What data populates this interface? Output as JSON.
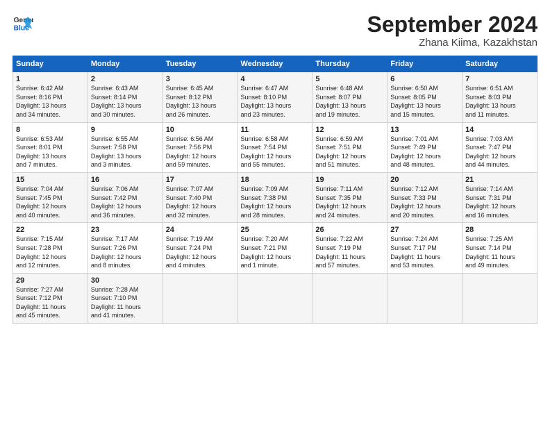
{
  "header": {
    "logo_line1": "General",
    "logo_line2": "Blue",
    "title": "September 2024",
    "subtitle": "Zhana Kiima, Kazakhstan"
  },
  "columns": [
    "Sunday",
    "Monday",
    "Tuesday",
    "Wednesday",
    "Thursday",
    "Friday",
    "Saturday"
  ],
  "weeks": [
    [
      {
        "day": "1",
        "line1": "Sunrise: 6:42 AM",
        "line2": "Sunset: 8:16 PM",
        "line3": "Daylight: 13 hours",
        "line4": "and 34 minutes."
      },
      {
        "day": "2",
        "line1": "Sunrise: 6:43 AM",
        "line2": "Sunset: 8:14 PM",
        "line3": "Daylight: 13 hours",
        "line4": "and 30 minutes."
      },
      {
        "day": "3",
        "line1": "Sunrise: 6:45 AM",
        "line2": "Sunset: 8:12 PM",
        "line3": "Daylight: 13 hours",
        "line4": "and 26 minutes."
      },
      {
        "day": "4",
        "line1": "Sunrise: 6:47 AM",
        "line2": "Sunset: 8:10 PM",
        "line3": "Daylight: 13 hours",
        "line4": "and 23 minutes."
      },
      {
        "day": "5",
        "line1": "Sunrise: 6:48 AM",
        "line2": "Sunset: 8:07 PM",
        "line3": "Daylight: 13 hours",
        "line4": "and 19 minutes."
      },
      {
        "day": "6",
        "line1": "Sunrise: 6:50 AM",
        "line2": "Sunset: 8:05 PM",
        "line3": "Daylight: 13 hours",
        "line4": "and 15 minutes."
      },
      {
        "day": "7",
        "line1": "Sunrise: 6:51 AM",
        "line2": "Sunset: 8:03 PM",
        "line3": "Daylight: 13 hours",
        "line4": "and 11 minutes."
      }
    ],
    [
      {
        "day": "8",
        "line1": "Sunrise: 6:53 AM",
        "line2": "Sunset: 8:01 PM",
        "line3": "Daylight: 13 hours",
        "line4": "and 7 minutes."
      },
      {
        "day": "9",
        "line1": "Sunrise: 6:55 AM",
        "line2": "Sunset: 7:58 PM",
        "line3": "Daylight: 13 hours",
        "line4": "and 3 minutes."
      },
      {
        "day": "10",
        "line1": "Sunrise: 6:56 AM",
        "line2": "Sunset: 7:56 PM",
        "line3": "Daylight: 12 hours",
        "line4": "and 59 minutes."
      },
      {
        "day": "11",
        "line1": "Sunrise: 6:58 AM",
        "line2": "Sunset: 7:54 PM",
        "line3": "Daylight: 12 hours",
        "line4": "and 55 minutes."
      },
      {
        "day": "12",
        "line1": "Sunrise: 6:59 AM",
        "line2": "Sunset: 7:51 PM",
        "line3": "Daylight: 12 hours",
        "line4": "and 51 minutes."
      },
      {
        "day": "13",
        "line1": "Sunrise: 7:01 AM",
        "line2": "Sunset: 7:49 PM",
        "line3": "Daylight: 12 hours",
        "line4": "and 48 minutes."
      },
      {
        "day": "14",
        "line1": "Sunrise: 7:03 AM",
        "line2": "Sunset: 7:47 PM",
        "line3": "Daylight: 12 hours",
        "line4": "and 44 minutes."
      }
    ],
    [
      {
        "day": "15",
        "line1": "Sunrise: 7:04 AM",
        "line2": "Sunset: 7:45 PM",
        "line3": "Daylight: 12 hours",
        "line4": "and 40 minutes."
      },
      {
        "day": "16",
        "line1": "Sunrise: 7:06 AM",
        "line2": "Sunset: 7:42 PM",
        "line3": "Daylight: 12 hours",
        "line4": "and 36 minutes."
      },
      {
        "day": "17",
        "line1": "Sunrise: 7:07 AM",
        "line2": "Sunset: 7:40 PM",
        "line3": "Daylight: 12 hours",
        "line4": "and 32 minutes."
      },
      {
        "day": "18",
        "line1": "Sunrise: 7:09 AM",
        "line2": "Sunset: 7:38 PM",
        "line3": "Daylight: 12 hours",
        "line4": "and 28 minutes."
      },
      {
        "day": "19",
        "line1": "Sunrise: 7:11 AM",
        "line2": "Sunset: 7:35 PM",
        "line3": "Daylight: 12 hours",
        "line4": "and 24 minutes."
      },
      {
        "day": "20",
        "line1": "Sunrise: 7:12 AM",
        "line2": "Sunset: 7:33 PM",
        "line3": "Daylight: 12 hours",
        "line4": "and 20 minutes."
      },
      {
        "day": "21",
        "line1": "Sunrise: 7:14 AM",
        "line2": "Sunset: 7:31 PM",
        "line3": "Daylight: 12 hours",
        "line4": "and 16 minutes."
      }
    ],
    [
      {
        "day": "22",
        "line1": "Sunrise: 7:15 AM",
        "line2": "Sunset: 7:28 PM",
        "line3": "Daylight: 12 hours",
        "line4": "and 12 minutes."
      },
      {
        "day": "23",
        "line1": "Sunrise: 7:17 AM",
        "line2": "Sunset: 7:26 PM",
        "line3": "Daylight: 12 hours",
        "line4": "and 8 minutes."
      },
      {
        "day": "24",
        "line1": "Sunrise: 7:19 AM",
        "line2": "Sunset: 7:24 PM",
        "line3": "Daylight: 12 hours",
        "line4": "and 4 minutes."
      },
      {
        "day": "25",
        "line1": "Sunrise: 7:20 AM",
        "line2": "Sunset: 7:21 PM",
        "line3": "Daylight: 12 hours",
        "line4": "and 1 minute."
      },
      {
        "day": "26",
        "line1": "Sunrise: 7:22 AM",
        "line2": "Sunset: 7:19 PM",
        "line3": "Daylight: 11 hours",
        "line4": "and 57 minutes."
      },
      {
        "day": "27",
        "line1": "Sunrise: 7:24 AM",
        "line2": "Sunset: 7:17 PM",
        "line3": "Daylight: 11 hours",
        "line4": "and 53 minutes."
      },
      {
        "day": "28",
        "line1": "Sunrise: 7:25 AM",
        "line2": "Sunset: 7:14 PM",
        "line3": "Daylight: 11 hours",
        "line4": "and 49 minutes."
      }
    ],
    [
      {
        "day": "29",
        "line1": "Sunrise: 7:27 AM",
        "line2": "Sunset: 7:12 PM",
        "line3": "Daylight: 11 hours",
        "line4": "and 45 minutes."
      },
      {
        "day": "30",
        "line1": "Sunrise: 7:28 AM",
        "line2": "Sunset: 7:10 PM",
        "line3": "Daylight: 11 hours",
        "line4": "and 41 minutes."
      },
      {
        "day": "",
        "line1": "",
        "line2": "",
        "line3": "",
        "line4": ""
      },
      {
        "day": "",
        "line1": "",
        "line2": "",
        "line3": "",
        "line4": ""
      },
      {
        "day": "",
        "line1": "",
        "line2": "",
        "line3": "",
        "line4": ""
      },
      {
        "day": "",
        "line1": "",
        "line2": "",
        "line3": "",
        "line4": ""
      },
      {
        "day": "",
        "line1": "",
        "line2": "",
        "line3": "",
        "line4": ""
      }
    ]
  ]
}
